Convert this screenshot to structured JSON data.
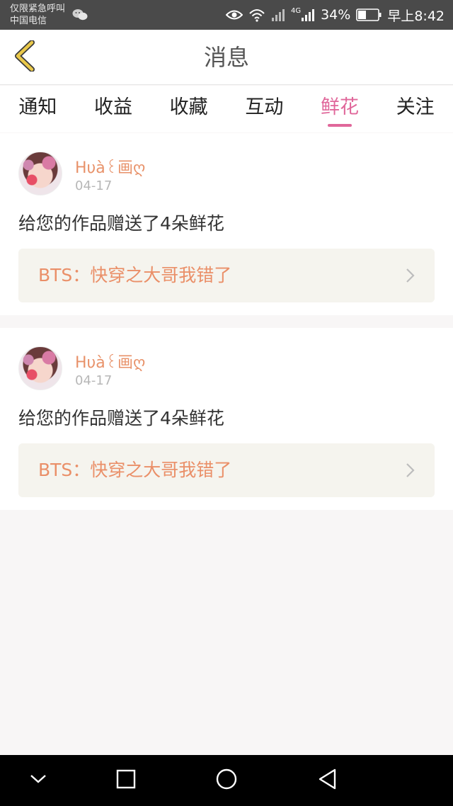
{
  "status_bar": {
    "line1": "仅限紧急呼叫",
    "line2": "中国电信",
    "network": "4G",
    "battery": "34%",
    "time": "早上8:42"
  },
  "header": {
    "title": "消息"
  },
  "tabs": [
    {
      "label": "通知",
      "active": false
    },
    {
      "label": "收益",
      "active": false
    },
    {
      "label": "收藏",
      "active": false
    },
    {
      "label": "互动",
      "active": false
    },
    {
      "label": "鲜花",
      "active": true
    },
    {
      "label": "关注",
      "active": false
    }
  ],
  "messages": [
    {
      "username": "Hυà꒰画ღ",
      "date": "04-17",
      "text": "给您的作品赠送了4朵鲜花",
      "work_title": "BTS：快穿之大哥我错了"
    },
    {
      "username": "Hυà꒰画ღ",
      "date": "04-17",
      "text": "给您的作品赠送了4朵鲜花",
      "work_title": "BTS：快穿之大哥我错了"
    }
  ],
  "colors": {
    "accent": "#e0679a",
    "username": "#e8926a",
    "link_text": "#ea8f68",
    "link_bg": "#f5f4ee",
    "back_icon": "#e9c84a"
  },
  "icons": {
    "back": "chevron-left-icon",
    "eye": "eye-icon",
    "wifi": "wifi-icon",
    "signal": "signal-icon",
    "battery": "battery-icon",
    "wechat": "wechat-icon",
    "nav_down": "chevron-down-icon",
    "nav_recents": "square-icon",
    "nav_home": "circle-icon",
    "nav_back": "triangle-back-icon"
  }
}
